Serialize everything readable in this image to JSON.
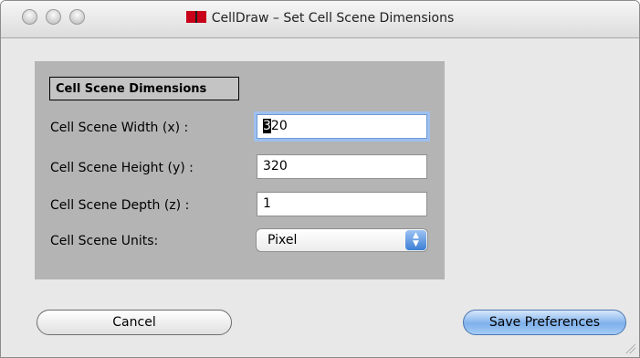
{
  "window": {
    "title": "CellDraw – Set Cell Scene Dimensions"
  },
  "panel": {
    "title": "Cell Scene Dimensions",
    "fields": [
      {
        "label": "Cell Scene Width (x) :",
        "value": "320"
      },
      {
        "label": "Cell Scene Height (y) :",
        "value": "320"
      },
      {
        "label": "Cell Scene Depth (z) :",
        "value": "1"
      }
    ],
    "units": {
      "label": "Cell Scene Units:",
      "selected": "Pixel"
    }
  },
  "buttons": {
    "cancel": "Cancel",
    "save": "Save Preferences"
  },
  "colors": {
    "panel": "#b4b4b4",
    "focus_ring": "#9ec0ef",
    "default_button": "#7fb1ec"
  }
}
